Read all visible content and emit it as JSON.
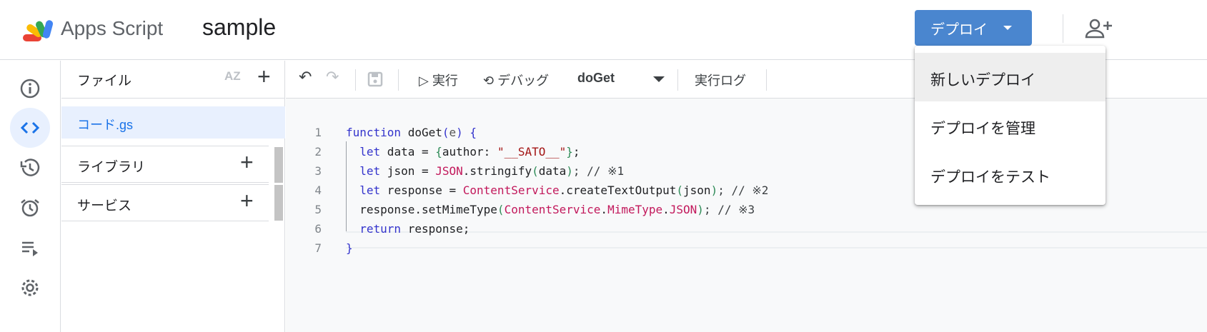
{
  "header": {
    "app_name": "Apps Script",
    "project_name": "sample",
    "deploy_label": "デプロイ"
  },
  "files": {
    "title": "ファイル",
    "file": "コード.gs",
    "libraries": "ライブラリ",
    "services": "サービス"
  },
  "toolbar": {
    "run": "実行",
    "debug": "デバッグ",
    "function": "doGet",
    "log": "実行ログ"
  },
  "menu": {
    "items": [
      "新しいデプロイ",
      "デプロイを管理",
      "デプロイをテスト"
    ]
  },
  "code": {
    "line_numbers": [
      "1",
      "2",
      "3",
      "4",
      "5",
      "6",
      "7"
    ],
    "lines": [
      [
        [
          "function",
          "kw"
        ],
        [
          " doGet",
          ""
        ],
        [
          "(",
          "br1"
        ],
        [
          "e",
          "pa"
        ],
        [
          ")",
          "br1"
        ],
        [
          " ",
          ""
        ],
        [
          "{",
          "br1"
        ]
      ],
      [
        [
          "  let",
          "kw"
        ],
        [
          " data = ",
          ""
        ],
        [
          "{",
          "br2"
        ],
        [
          "author: ",
          ""
        ],
        [
          "\"__SATO__\"",
          "str"
        ],
        [
          "}",
          "br2"
        ],
        [
          ";",
          ""
        ]
      ],
      [
        [
          "  let",
          "kw"
        ],
        [
          " json = ",
          ""
        ],
        [
          "JSON",
          "cls"
        ],
        [
          ".stringify",
          ""
        ],
        [
          "(",
          "br2"
        ],
        [
          "data",
          ""
        ],
        [
          ")",
          "br2"
        ],
        [
          "; // ※1",
          "cm"
        ]
      ],
      [
        [
          "  let",
          "kw"
        ],
        [
          " response = ",
          ""
        ],
        [
          "ContentService",
          "cls"
        ],
        [
          ".createTextOutput",
          ""
        ],
        [
          "(",
          "br2"
        ],
        [
          "json",
          ""
        ],
        [
          ")",
          "br2"
        ],
        [
          "; // ※2",
          "cm"
        ]
      ],
      [
        [
          "  response.setMimeType",
          ""
        ],
        [
          "(",
          "br2"
        ],
        [
          "ContentService",
          "cls"
        ],
        [
          ".",
          ""
        ],
        [
          "MimeType",
          "cls"
        ],
        [
          ".",
          ""
        ],
        [
          "JSON",
          "cls"
        ],
        [
          ")",
          "br2"
        ],
        [
          "; // ※3",
          "cm"
        ]
      ],
      [
        [
          "  return",
          "kw"
        ],
        [
          " response;",
          ""
        ]
      ],
      [
        [
          "}",
          "br1"
        ]
      ]
    ]
  }
}
